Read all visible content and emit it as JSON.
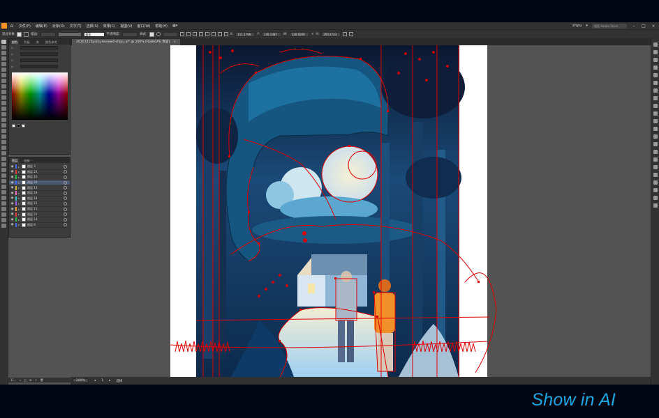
{
  "app": {
    "menu": [
      "文件(F)",
      "编辑(E)",
      "对象(O)",
      "文字(T)",
      "选择(S)",
      "效果(C)",
      "视图(V)",
      "窗口(W)",
      "帮助(H)"
    ],
    "workspace": "shipu",
    "search_placeholder": "搜索 Adobe Stock"
  },
  "control_bar": {
    "selection_label": "混合对象",
    "stroke_label": "描边:",
    "style_value": "基本",
    "opacity_label": "不透明度:",
    "style_label": "样式:",
    "x_label": "X:",
    "x_value": "111.1799",
    "y_label": "Y:",
    "y_value": "148.1487",
    "w_label": "W:",
    "w_value": "228.6009",
    "h_label": "H:",
    "h_value": "294.4743"
  },
  "panels": {
    "properties_tabs": [
      "颜色",
      "色板",
      "库",
      "颜色参考"
    ],
    "layers_tabs": [
      "图层",
      "画板"
    ],
    "layers": [
      {
        "name": "图层 3",
        "color": "#4a6cf5",
        "selected": false
      },
      {
        "name": "图层 22",
        "color": "#e03c3c",
        "selected": false
      },
      {
        "name": "图层 16",
        "color": "#2bbb4a",
        "selected": false
      },
      {
        "name": "图层 20",
        "color": "#3c6cf0",
        "selected": true
      },
      {
        "name": "图层 13",
        "color": "#d2b43c",
        "selected": false
      },
      {
        "name": "图层 19",
        "color": "#f06ec8",
        "selected": false
      },
      {
        "name": "图层 18",
        "color": "#3cc8c8",
        "selected": false
      },
      {
        "name": "图层 15",
        "color": "#9a5cf0",
        "selected": false
      },
      {
        "name": "图层 11",
        "color": "#f0a03c",
        "selected": false
      },
      {
        "name": "图层 21",
        "color": "#e03c3c",
        "selected": false
      },
      {
        "name": "图层 14",
        "color": "#2bbb4a",
        "selected": false
      },
      {
        "name": "图层 8",
        "color": "#4a6cf5",
        "selected": false
      }
    ],
    "layers_count": "11..."
  },
  "document": {
    "tab_title": "20201215policyreview4-shipu.ai* @ 200% (RGB/GPU 预览)",
    "zoom": "200%",
    "page": "1",
    "status_tool": "选择"
  },
  "caption": "Show in AI",
  "colors": {
    "accent": "#1ba6e4",
    "path_red": "#e00000",
    "panel_bg": "#323232",
    "canvas_bg": "#535353"
  }
}
